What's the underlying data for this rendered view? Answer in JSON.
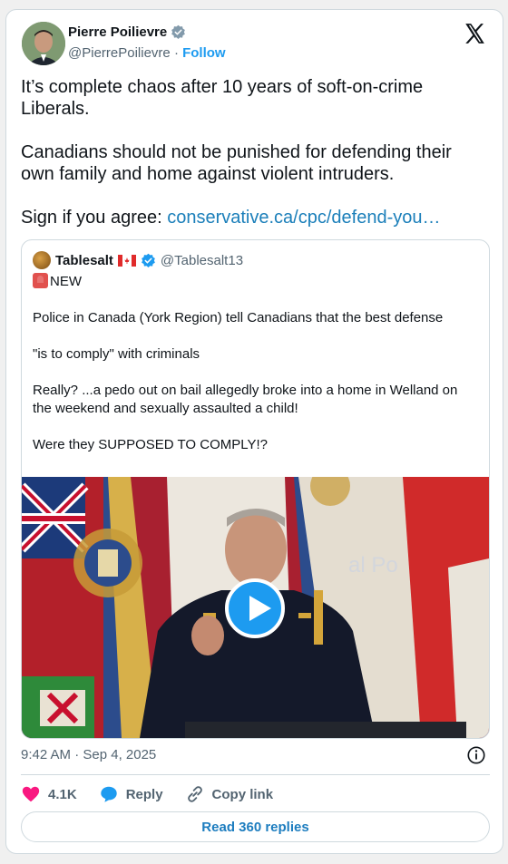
{
  "author": {
    "name": "Pierre Poilievre",
    "handle": "@PierrePoilievre",
    "separator": "·",
    "follow_label": "Follow"
  },
  "tweet": {
    "line1": "It’s complete chaos after 10 years of soft-on-crime Liberals.",
    "line2": "Canadians should not be punished for defending their own family and home against violent intruders.",
    "line3_prefix": "Sign if you agree: ",
    "link_text": "conservative.ca/cpc/defend-you…"
  },
  "quote": {
    "name": "Tablesalt",
    "handle": "@Tablesalt13",
    "badge": "NEW",
    "lines": [
      "Police in Canada (York Region) tell Canadians that the best defense",
      "\"is to comply\" with criminals",
      "Really? ...a pedo out on bail allegedly broke into a home in Welland on the weekend and sexually assaulted a child!",
      "Were they SUPPOSED TO COMPLY!?"
    ],
    "media_sign_text": "al Po"
  },
  "meta": {
    "timestamp": "9:42 AM · Sep 4, 2025"
  },
  "actions": {
    "likes": "4.1K",
    "reply_label": "Reply",
    "copy_label": "Copy link"
  },
  "read_replies_label": "Read 360 replies",
  "colors": {
    "accent": "#1d9bf0",
    "link": "#1b7fba",
    "like": "#f91880",
    "muted": "#536471"
  }
}
